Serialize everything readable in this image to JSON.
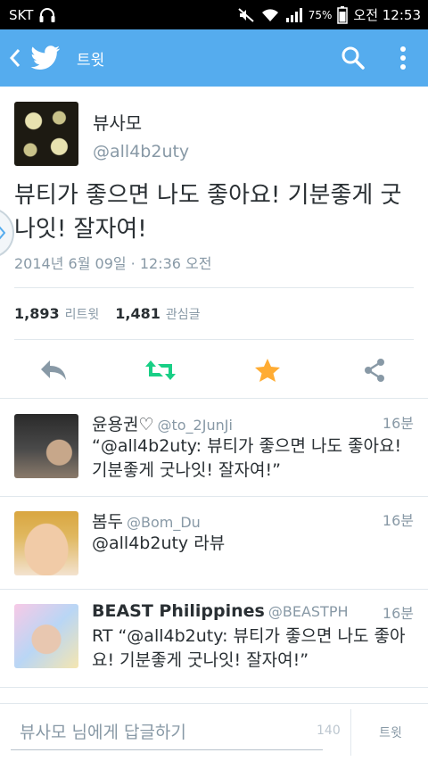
{
  "status_bar": {
    "carrier": "SKT",
    "battery": "75%",
    "time": "오전 12:53"
  },
  "action_bar": {
    "title": "트윗"
  },
  "tweet": {
    "name": "뷰사모",
    "handle": "@all4b2uty",
    "text": "뷰티가 좋으면 나도 좋아요! 기분좋게 굿나잇! 잘자여!",
    "timestamp": "2014년 6월 09일 · 12:36 오전",
    "retweets_count": "1,893",
    "retweets_label": "리트윗",
    "favorites_count": "1,481",
    "favorites_label": "관심글"
  },
  "replies": [
    {
      "name": "윤용권♡",
      "handle": "@to_2JunJi",
      "time": "16분",
      "text": "“@all4b2uty: 뷰티가 좋으면 나도 좋아요! 기분좋게 굿나잇! 잘자여!”"
    },
    {
      "name": "봄두",
      "handle": "@Bom_Du",
      "time": "16분",
      "text": "@all4b2uty 라뷰"
    },
    {
      "name": "BEAST Philippines",
      "handle": "@BEASTPH",
      "time": "16분",
      "text": "RT “@all4b2uty: 뷰티가 좋으면 나도 좋아요! 기분좋게 굿나잇! 잘자여!”"
    }
  ],
  "compose": {
    "placeholder": "뷰사모 님에게 답글하기",
    "char_count": "140",
    "send_label": "트윗"
  },
  "colors": {
    "brand": "#55acee",
    "retweet": "#19cf86",
    "favorite": "#ffac33",
    "muted": "#8899a6"
  }
}
